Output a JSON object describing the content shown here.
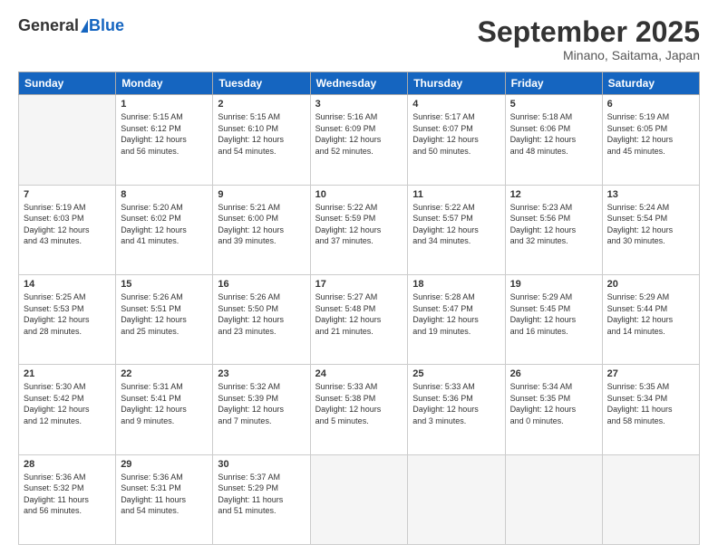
{
  "logo": {
    "general": "General",
    "blue": "Blue"
  },
  "title": "September 2025",
  "subtitle": "Minano, Saitama, Japan",
  "days_header": [
    "Sunday",
    "Monday",
    "Tuesday",
    "Wednesday",
    "Thursday",
    "Friday",
    "Saturday"
  ],
  "weeks": [
    [
      {
        "num": "",
        "info": ""
      },
      {
        "num": "1",
        "info": "Sunrise: 5:15 AM\nSunset: 6:12 PM\nDaylight: 12 hours\nand 56 minutes."
      },
      {
        "num": "2",
        "info": "Sunrise: 5:15 AM\nSunset: 6:10 PM\nDaylight: 12 hours\nand 54 minutes."
      },
      {
        "num": "3",
        "info": "Sunrise: 5:16 AM\nSunset: 6:09 PM\nDaylight: 12 hours\nand 52 minutes."
      },
      {
        "num": "4",
        "info": "Sunrise: 5:17 AM\nSunset: 6:07 PM\nDaylight: 12 hours\nand 50 minutes."
      },
      {
        "num": "5",
        "info": "Sunrise: 5:18 AM\nSunset: 6:06 PM\nDaylight: 12 hours\nand 48 minutes."
      },
      {
        "num": "6",
        "info": "Sunrise: 5:19 AM\nSunset: 6:05 PM\nDaylight: 12 hours\nand 45 minutes."
      }
    ],
    [
      {
        "num": "7",
        "info": "Sunrise: 5:19 AM\nSunset: 6:03 PM\nDaylight: 12 hours\nand 43 minutes."
      },
      {
        "num": "8",
        "info": "Sunrise: 5:20 AM\nSunset: 6:02 PM\nDaylight: 12 hours\nand 41 minutes."
      },
      {
        "num": "9",
        "info": "Sunrise: 5:21 AM\nSunset: 6:00 PM\nDaylight: 12 hours\nand 39 minutes."
      },
      {
        "num": "10",
        "info": "Sunrise: 5:22 AM\nSunset: 5:59 PM\nDaylight: 12 hours\nand 37 minutes."
      },
      {
        "num": "11",
        "info": "Sunrise: 5:22 AM\nSunset: 5:57 PM\nDaylight: 12 hours\nand 34 minutes."
      },
      {
        "num": "12",
        "info": "Sunrise: 5:23 AM\nSunset: 5:56 PM\nDaylight: 12 hours\nand 32 minutes."
      },
      {
        "num": "13",
        "info": "Sunrise: 5:24 AM\nSunset: 5:54 PM\nDaylight: 12 hours\nand 30 minutes."
      }
    ],
    [
      {
        "num": "14",
        "info": "Sunrise: 5:25 AM\nSunset: 5:53 PM\nDaylight: 12 hours\nand 28 minutes."
      },
      {
        "num": "15",
        "info": "Sunrise: 5:26 AM\nSunset: 5:51 PM\nDaylight: 12 hours\nand 25 minutes."
      },
      {
        "num": "16",
        "info": "Sunrise: 5:26 AM\nSunset: 5:50 PM\nDaylight: 12 hours\nand 23 minutes."
      },
      {
        "num": "17",
        "info": "Sunrise: 5:27 AM\nSunset: 5:48 PM\nDaylight: 12 hours\nand 21 minutes."
      },
      {
        "num": "18",
        "info": "Sunrise: 5:28 AM\nSunset: 5:47 PM\nDaylight: 12 hours\nand 19 minutes."
      },
      {
        "num": "19",
        "info": "Sunrise: 5:29 AM\nSunset: 5:45 PM\nDaylight: 12 hours\nand 16 minutes."
      },
      {
        "num": "20",
        "info": "Sunrise: 5:29 AM\nSunset: 5:44 PM\nDaylight: 12 hours\nand 14 minutes."
      }
    ],
    [
      {
        "num": "21",
        "info": "Sunrise: 5:30 AM\nSunset: 5:42 PM\nDaylight: 12 hours\nand 12 minutes."
      },
      {
        "num": "22",
        "info": "Sunrise: 5:31 AM\nSunset: 5:41 PM\nDaylight: 12 hours\nand 9 minutes."
      },
      {
        "num": "23",
        "info": "Sunrise: 5:32 AM\nSunset: 5:39 PM\nDaylight: 12 hours\nand 7 minutes."
      },
      {
        "num": "24",
        "info": "Sunrise: 5:33 AM\nSunset: 5:38 PM\nDaylight: 12 hours\nand 5 minutes."
      },
      {
        "num": "25",
        "info": "Sunrise: 5:33 AM\nSunset: 5:36 PM\nDaylight: 12 hours\nand 3 minutes."
      },
      {
        "num": "26",
        "info": "Sunrise: 5:34 AM\nSunset: 5:35 PM\nDaylight: 12 hours\nand 0 minutes."
      },
      {
        "num": "27",
        "info": "Sunrise: 5:35 AM\nSunset: 5:34 PM\nDaylight: 11 hours\nand 58 minutes."
      }
    ],
    [
      {
        "num": "28",
        "info": "Sunrise: 5:36 AM\nSunset: 5:32 PM\nDaylight: 11 hours\nand 56 minutes."
      },
      {
        "num": "29",
        "info": "Sunrise: 5:36 AM\nSunset: 5:31 PM\nDaylight: 11 hours\nand 54 minutes."
      },
      {
        "num": "30",
        "info": "Sunrise: 5:37 AM\nSunset: 5:29 PM\nDaylight: 11 hours\nand 51 minutes."
      },
      {
        "num": "",
        "info": ""
      },
      {
        "num": "",
        "info": ""
      },
      {
        "num": "",
        "info": ""
      },
      {
        "num": "",
        "info": ""
      }
    ]
  ]
}
